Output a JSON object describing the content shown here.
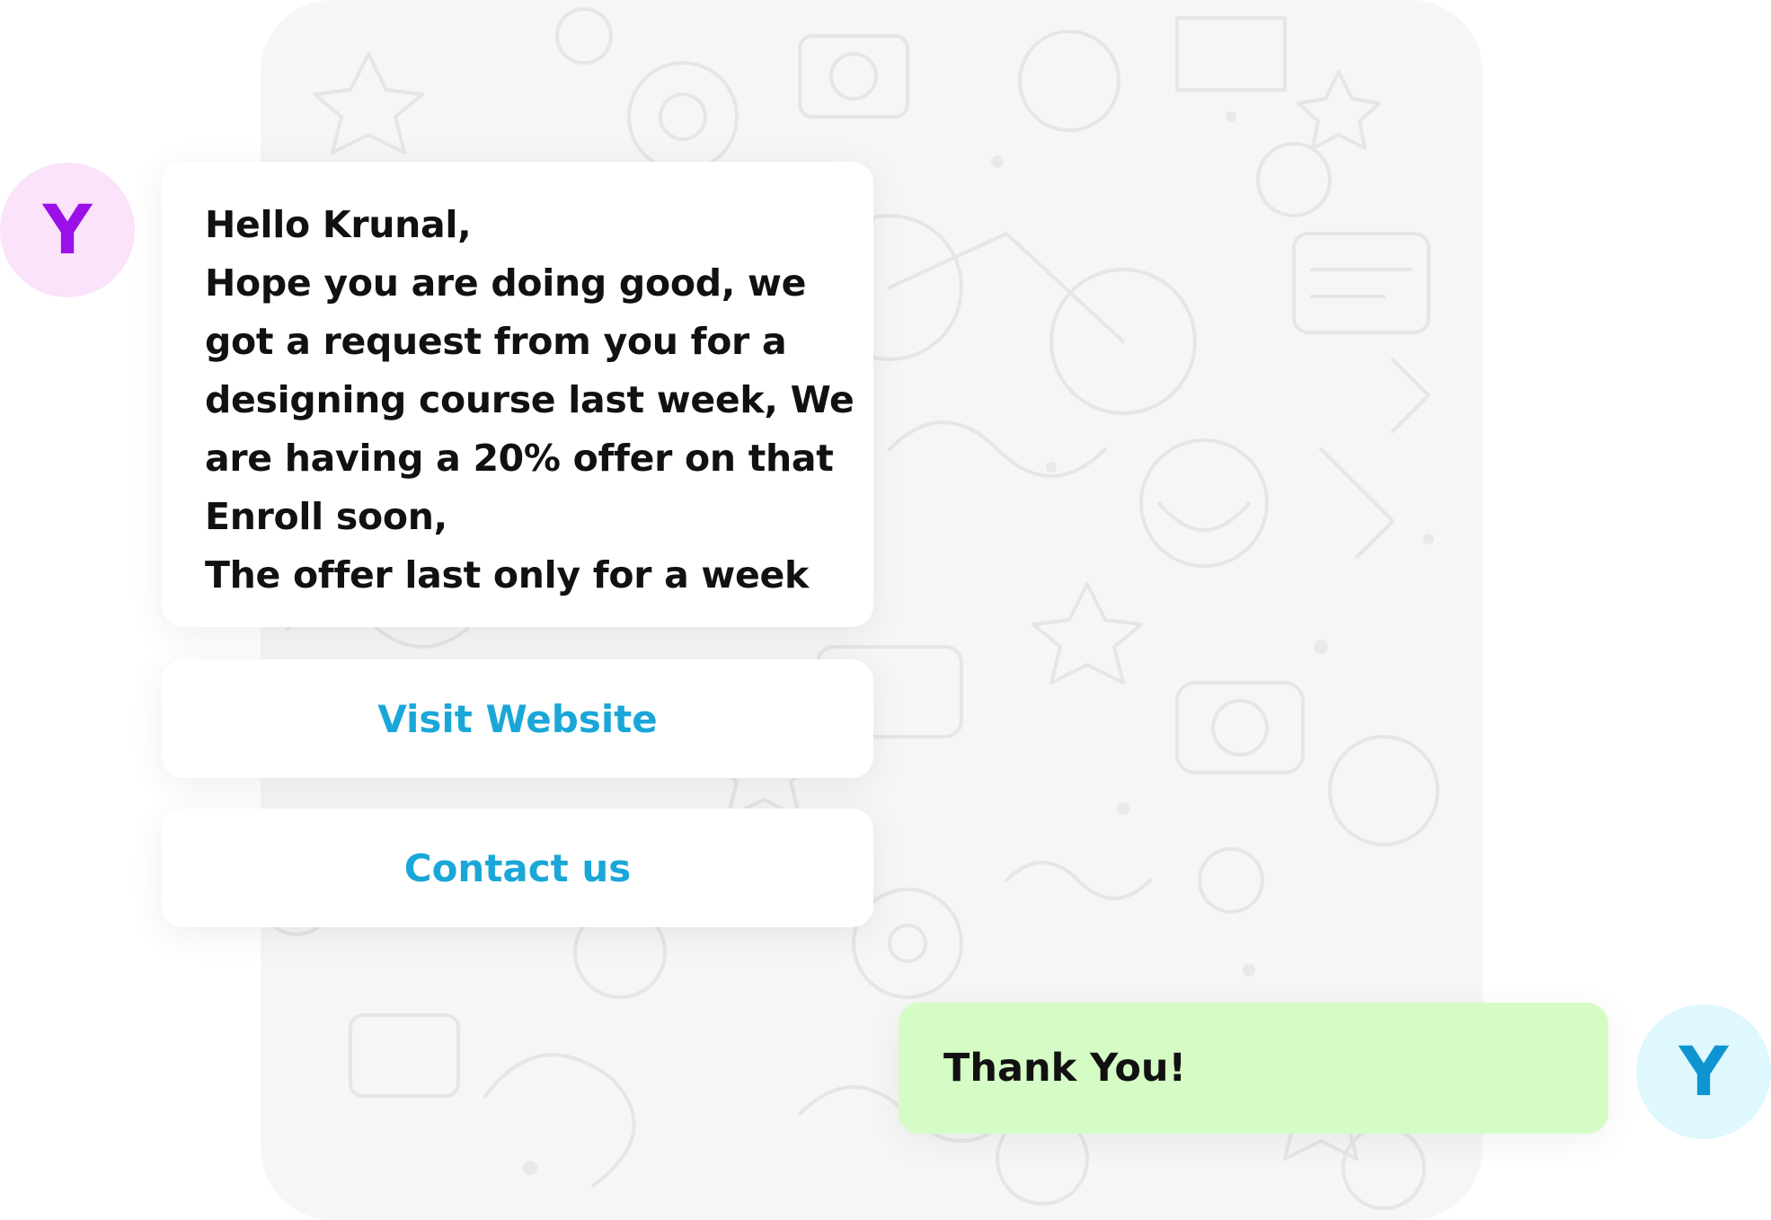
{
  "conversation": {
    "incoming": {
      "avatar_letter": "Y",
      "message_lines": [
        "Hello Krunal,",
        "Hope you are doing good, we",
        "got a request from you for a",
        "designing course last week, We",
        "are having a 20% offer on that",
        "Enroll soon,",
        "The offer last only for a week"
      ],
      "buttons": [
        {
          "label": "Visit Website"
        },
        {
          "label": "Contact us"
        }
      ]
    },
    "outgoing": {
      "avatar_letter": "Y",
      "message": "Thank You!"
    }
  },
  "colors": {
    "incoming_avatar_bg": "#fbe3fb",
    "incoming_avatar_text": "#9a10e8",
    "outgoing_avatar_bg": "#def8fd",
    "outgoing_avatar_text": "#0e95d1",
    "button_text": "#1aa7d8",
    "outgoing_bubble": "#d5fcc4",
    "chat_background": "#f6f6f6"
  }
}
